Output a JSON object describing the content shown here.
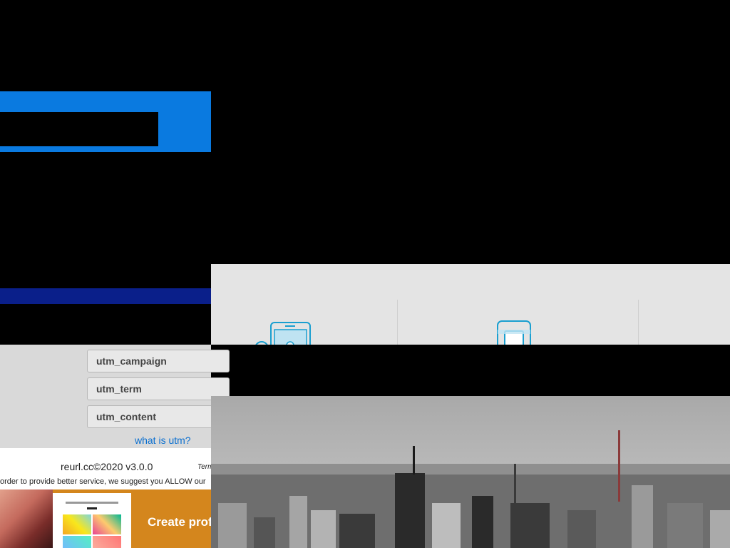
{
  "utm": {
    "fields": [
      {
        "label": "utm_campaign"
      },
      {
        "label": "utm_term"
      },
      {
        "label": "utm_content"
      }
    ],
    "help_link": "what is utm?"
  },
  "footer": {
    "copyright": "reurl.cc©2020 v3.0.0",
    "terms": "Term",
    "notice": "order to provide better service, we suggest you ALLOW our"
  },
  "ad": {
    "headline": "Create prof"
  },
  "colors": {
    "brand_blue": "#0a7ae0",
    "navy": "#0a1f8a",
    "link": "#0a6fd0",
    "icon_cyan": "#1a9fd0",
    "ad_orange": "#d4861d"
  },
  "icons": [
    "mobile-device-icon",
    "printer-icon"
  ]
}
